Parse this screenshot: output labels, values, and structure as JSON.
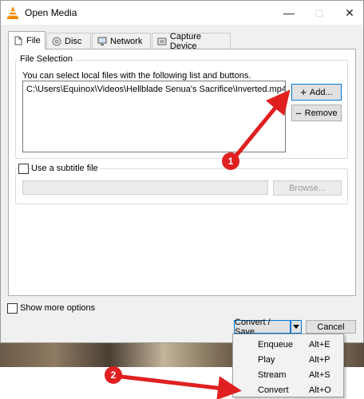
{
  "window": {
    "title": "Open Media"
  },
  "tabs": [
    {
      "label": "File",
      "icon": "file-icon"
    },
    {
      "label": "Disc",
      "icon": "disc-icon"
    },
    {
      "label": "Network",
      "icon": "network-icon"
    },
    {
      "label": "Capture Device",
      "icon": "capture-device-icon"
    }
  ],
  "file_selection": {
    "group_label": "File Selection",
    "description": "You can select local files with the following list and buttons.",
    "files": [
      "C:\\Users\\Equinox\\Videos\\Hellblade  Senua's Sacrifice\\Inverted.mp4"
    ],
    "add_label": "Add...",
    "remove_label": "Remove"
  },
  "subtitle": {
    "checkbox_label": "Use a subtitle file",
    "browse_label": "Browse..."
  },
  "show_more_label": "Show more options",
  "convert_label": "Convert / Save",
  "cancel_label": "Cancel",
  "menu": [
    {
      "label": "Enqueue",
      "shortcut": "Alt+E"
    },
    {
      "label": "Play",
      "shortcut": "Alt+P"
    },
    {
      "label": "Stream",
      "shortcut": "Alt+S"
    },
    {
      "label": "Convert",
      "shortcut": "Alt+O"
    }
  ],
  "annotations": [
    "1",
    "2"
  ],
  "colors": {
    "accent": "#0078d7",
    "annotation": "#e02020",
    "vlc_orange": "#f08a00"
  }
}
